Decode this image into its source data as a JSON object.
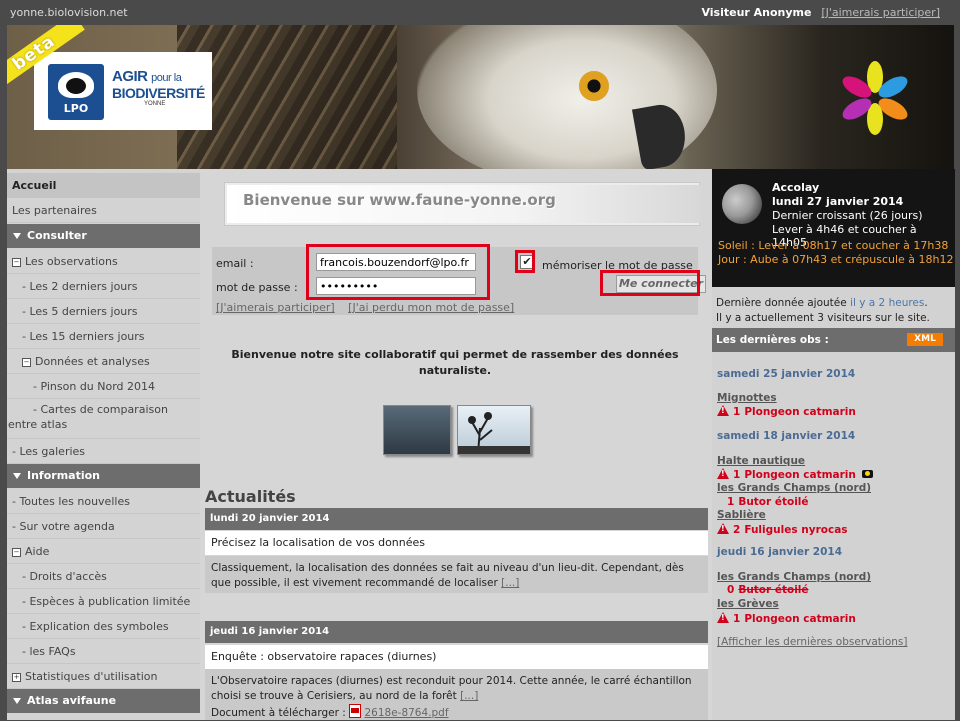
{
  "topbar": {
    "site": "yonne.biolovision.net",
    "visitor": "Visiteur Anonyme",
    "participate": "[J'aimerais participer]"
  },
  "banner": {
    "beta": "beta",
    "lpo": "LPO",
    "agir": "AGIR",
    "pour_la": "pour la",
    "biodiversite": "BIODIVERSITÉ",
    "yonne": "YONNE"
  },
  "nav": {
    "home": "Accueil",
    "partners": "Les partenaires",
    "consulter": "Consulter",
    "observations": "Les observations",
    "last2": "- Les 2 derniers jours",
    "last5": "- Les 5 derniers jours",
    "last15": "- Les 15 derniers jours",
    "data_analysis": "Données et analyses",
    "pinson": "- Pinson du Nord 2014",
    "cartes": "- Cartes de comparaison",
    "cartes2": "entre atlas",
    "galeries": "- Les galeries",
    "information": "Information",
    "nouvelles": "- Toutes les nouvelles",
    "agenda": "- Sur votre agenda",
    "aide": "Aide",
    "droits": "- Droits d'accès",
    "especes": "- Espèces à publication limitée",
    "symboles": "- Explication des symboles",
    "faqs": "- les FAQs",
    "stats": "Statistiques d'utilisation",
    "atlas": "Atlas avifaune"
  },
  "center": {
    "welcome_title": "Bienvenue sur www.faune-yonne.org",
    "email_label": "email :",
    "email_value": "francois.bouzendorf@lpo.fr",
    "password_label": "mot de passe :",
    "password_value": "•••••••••",
    "remember_label": "mémoriser le mot de passe",
    "connect": "Me connecter",
    "link_participate": "[J'aimerais participer]",
    "link_lost": "[J'ai perdu mon mot de passe]",
    "intro": "Bienvenue notre site collaboratif qui permet de rassember des données naturaliste.",
    "actu_title": "Actualités",
    "news": [
      {
        "date": "lundi 20 janvier 2014",
        "title": "Précisez la localisation de vos données",
        "body": "Classiquement, la localisation des données se fait au niveau d'un lieu-dit. Cependant, dès que possible, il est vivement recommandé de localiser",
        "more": "[...]"
      },
      {
        "date": "jeudi 16 janvier 2014",
        "title": "Enquête : observatoire rapaces (diurnes)",
        "body": "L'Observatoire rapaces (diurnes) est reconduit pour 2014. Cette année, le carré échantillon choisi se trouve à Cerisiers, au nord de la forêt",
        "more": "[...]",
        "download_label": "Document à télécharger :",
        "download_file": "2618e-8764.pdf"
      }
    ]
  },
  "right": {
    "place": "Accolay",
    "date": "lundi 27 janvier 2014",
    "phase": "Dernier croissant (26 jours)",
    "moon_rise": "Lever à 4h46 et coucher à 14h05",
    "sun": "Soleil : Lever à 08h17 et coucher à 17h38",
    "day": "Jour : Aube à 07h43 et crépuscule à 18h12",
    "last_data_prefix": "Dernière donnée ajoutée",
    "last_data_link": "il y a 2 heures",
    "visitors": "Il y a actuellement 3 visiteurs sur le site.",
    "obs_head": "Les dernières obs :",
    "xml": "XML",
    "obs": {
      "d1": "samedi 25 janvier 2014",
      "l1": "Mignottes",
      "e1n": "1",
      "e1": "Plongeon catmarin",
      "d2": "samedi 18 janvier 2014",
      "l2": "Halte nautique",
      "e2n": "1",
      "e2": "Plongeon catmarin",
      "l3": "les Grands Champs (nord)",
      "e3n": "1",
      "e3": "Butor étoilé",
      "l4": "Sablière",
      "e4n": "2",
      "e4": "Fuligules nyrocas",
      "d3": "jeudi 16 janvier 2014",
      "l5": "les Grands Champs (nord)",
      "e5n": "0",
      "e5": "Butor étoilé",
      "l6": "les Grèves",
      "e6n": "1",
      "e6": "Plongeon catmarin"
    },
    "show_last": "[Afficher les dernières observations]"
  },
  "colors": {
    "accent_red": "#e0001a",
    "nav_dark": "#6d6d6d",
    "obs_red": "#d0021b",
    "sun_orange": "#f2a23a",
    "lpo_blue": "#1c4f92",
    "xml_orange": "#f47c00"
  }
}
